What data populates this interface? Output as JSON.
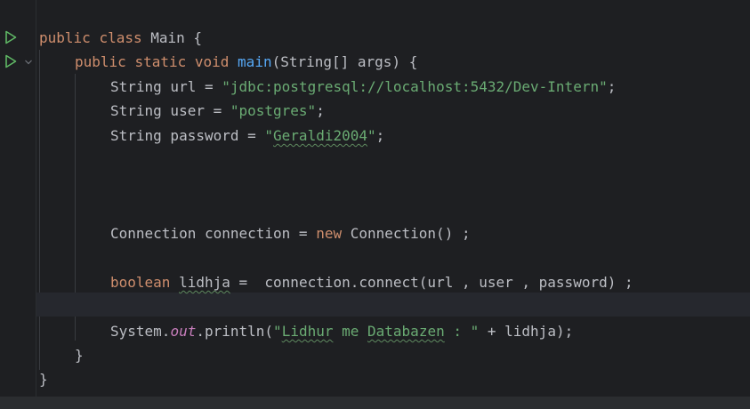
{
  "colors": {
    "background": "#1e1f22",
    "keyword": "#cf8e6d",
    "function": "#56a8f5",
    "string": "#6aab73",
    "static_field": "#c77dbb",
    "text": "#bcbec4",
    "run_icon": "#5fb865"
  },
  "gutter": {
    "icons": [
      "run-icon",
      "run-icon",
      "fold-icon"
    ]
  },
  "code": {
    "line1": {
      "kw1": "public",
      "kw2": "class",
      "name": "Main",
      "brace": "{"
    },
    "line2": {
      "kw1": "public",
      "kw2": "static",
      "kw3": "void",
      "method": "main",
      "params": "(String[] args) {"
    },
    "line3": {
      "type": "String url = ",
      "q1": "\"",
      "value": "jdbc:postgresql://localhost:5432/Dev-Intern",
      "q2": "\"",
      "end": ";"
    },
    "line4": {
      "type": "String user = ",
      "value": "\"postgres\"",
      "end": ";"
    },
    "line5": {
      "type": "String password = ",
      "q1": "\"",
      "value": "Geraldi2004",
      "q2": "\"",
      "end": ";"
    },
    "line6": {
      "pre": "Connection connection = ",
      "kw": "new",
      "post": " Connection() ;"
    },
    "line7": {
      "kw": "boolean",
      "var": "lidhja",
      "post": " =  connection.connect(url , user , password) ;"
    },
    "line8": {
      "pre": "System.",
      "field": "out",
      "mid": ".println(",
      "q1": "\"",
      "s1": "Lidhur",
      "s2": " me ",
      "s3": "Databazen",
      "s4": " : \"",
      "post": " + lidhja);"
    },
    "line9": {
      "brace": "}"
    },
    "line10": {
      "brace": "}"
    }
  }
}
